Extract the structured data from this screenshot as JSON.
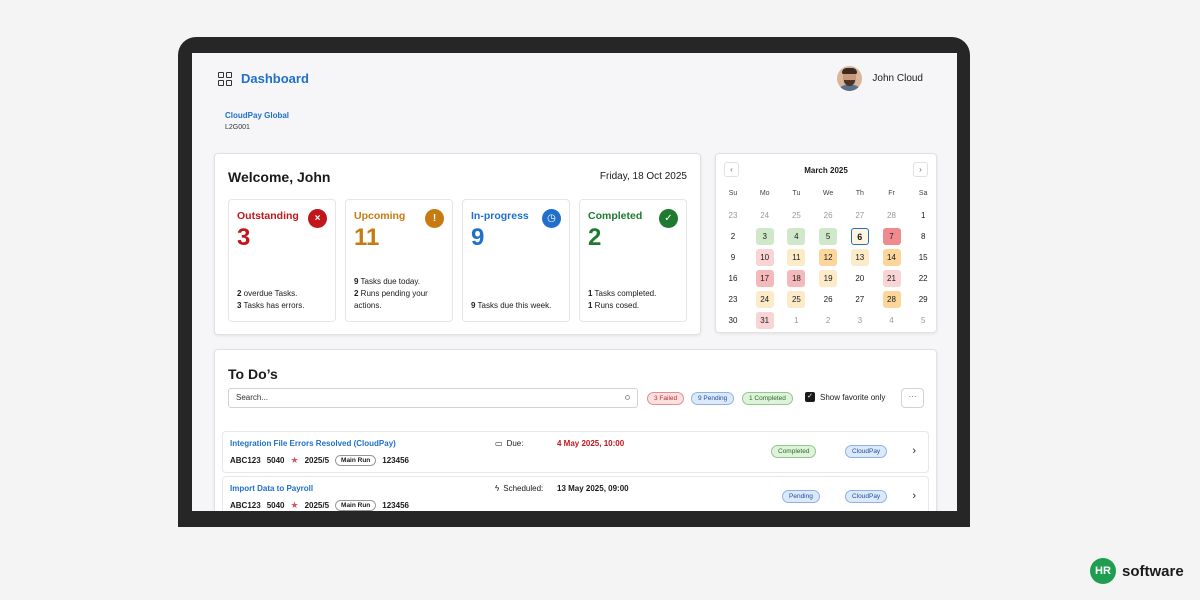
{
  "header": {
    "title": "Dashboard",
    "user_name": "John Cloud"
  },
  "company": {
    "name": "CloudPay Global",
    "code": "L2G001"
  },
  "welcome": {
    "greeting": "Welcome, John",
    "date": "Friday, 18 Oct 2025"
  },
  "stats": [
    {
      "label": "Outstanding",
      "value": "3",
      "color": "#c0161c",
      "icon": "error-circle-icon",
      "line1_num": "2",
      "line1_text": " overdue Tasks.",
      "line2_num": "3",
      "line2_text": " Tasks has errors."
    },
    {
      "label": "Upcoming",
      "value": "11",
      "color": "#c77a11",
      "icon": "alert-circle-icon",
      "line1_num": "9",
      "line1_text": " Tasks due today.",
      "line2_num": "2",
      "line2_text": " Runs pending your actions."
    },
    {
      "label": "In-progress",
      "value": "9",
      "color": "#1f6fcb",
      "icon": "clock-icon",
      "line1_num": "",
      "line1_text": "",
      "line2_num": "9",
      "line2_text": " Tasks due this week."
    },
    {
      "label": "Completed",
      "value": "2",
      "color": "#1d7a2e",
      "icon": "check-circle-icon",
      "line1_num": "1",
      "line1_text": " Tasks completed.",
      "line2_num": "1",
      "line2_text": " Runs cosed."
    }
  ],
  "calendar": {
    "month": "March 2025",
    "weekdays": [
      "Su",
      "Mo",
      "Tu",
      "We",
      "Th",
      "Fr",
      "Sa"
    ],
    "weeks": [
      [
        {
          "d": "23",
          "o": true
        },
        {
          "d": "24",
          "o": true
        },
        {
          "d": "25",
          "o": true
        },
        {
          "d": "26",
          "o": true
        },
        {
          "d": "27",
          "o": true
        },
        {
          "d": "28",
          "o": true
        },
        {
          "d": "1"
        }
      ],
      [
        {
          "d": "2"
        },
        {
          "d": "3",
          "s": "green"
        },
        {
          "d": "4",
          "s": "green"
        },
        {
          "d": "5",
          "s": "green"
        },
        {
          "d": "6",
          "s": "today"
        },
        {
          "d": "7",
          "s": "red"
        },
        {
          "d": "8"
        }
      ],
      [
        {
          "d": "9"
        },
        {
          "d": "10",
          "s": "pink"
        },
        {
          "d": "11",
          "s": "cream"
        },
        {
          "d": "12",
          "s": "orange"
        },
        {
          "d": "13",
          "s": "cream"
        },
        {
          "d": "14",
          "s": "orange"
        },
        {
          "d": "15"
        }
      ],
      [
        {
          "d": "16"
        },
        {
          "d": "17",
          "s": "rose"
        },
        {
          "d": "18",
          "s": "rose"
        },
        {
          "d": "19",
          "s": "cream"
        },
        {
          "d": "20"
        },
        {
          "d": "21",
          "s": "pink"
        },
        {
          "d": "22"
        }
      ],
      [
        {
          "d": "23"
        },
        {
          "d": "24",
          "s": "cream"
        },
        {
          "d": "25",
          "s": "cream"
        },
        {
          "d": "26"
        },
        {
          "d": "27"
        },
        {
          "d": "28",
          "s": "orange"
        },
        {
          "d": "29"
        }
      ],
      [
        {
          "d": "30"
        },
        {
          "d": "31",
          "s": "pink"
        },
        {
          "d": "1",
          "o": true
        },
        {
          "d": "2",
          "o": true
        },
        {
          "d": "3",
          "o": true
        },
        {
          "d": "4",
          "o": true
        },
        {
          "d": "5",
          "o": true
        }
      ]
    ]
  },
  "todo": {
    "title": "To Do’s",
    "search_placeholder": "Search...",
    "filters": [
      {
        "label": "3 Failed",
        "bg": "#fbe0e0",
        "border": "#e58c8c",
        "color": "#b23030"
      },
      {
        "label": "9 Pending",
        "bg": "#dce9fb",
        "border": "#8fb2e6",
        "color": "#1f4f9a"
      },
      {
        "label": "1 Completed",
        "bg": "#dff2dc",
        "border": "#8fcb87",
        "color": "#2d6b25"
      }
    ],
    "favorite_label": "Show favorite only",
    "more_label": "···",
    "tasks": [
      {
        "title": "Integration File Errors Resolved (CloudPay)",
        "code": "ABC123",
        "num": "5040",
        "period": "2025/5",
        "tag": "Main Run",
        "ref": "123456",
        "date_icon": "calendar-icon",
        "date_label": "Due:",
        "date_value": "4 May 2025, 10:00",
        "date_color": "#c0161c",
        "status": "Completed",
        "status_bg": "#dff2dc",
        "status_border": "#8fcb87",
        "status_color": "#2d6b25",
        "system": "CloudPay"
      },
      {
        "title": "Import Data to Payroll",
        "code": "ABC123",
        "num": "5040",
        "period": "2025/5",
        "tag": "Main Run",
        "ref": "123456",
        "date_icon": "lightning-icon",
        "date_label": "Scheduled:",
        "date_value": "13 May 2025, 09:00",
        "date_color": "#1a1a1a",
        "status": "Pending",
        "status_bg": "#dce9fb",
        "status_border": "#8fb2e6",
        "status_color": "#1f4f9a",
        "system": "CloudPay"
      }
    ]
  },
  "brand": {
    "logo": "HR",
    "name": "software"
  }
}
